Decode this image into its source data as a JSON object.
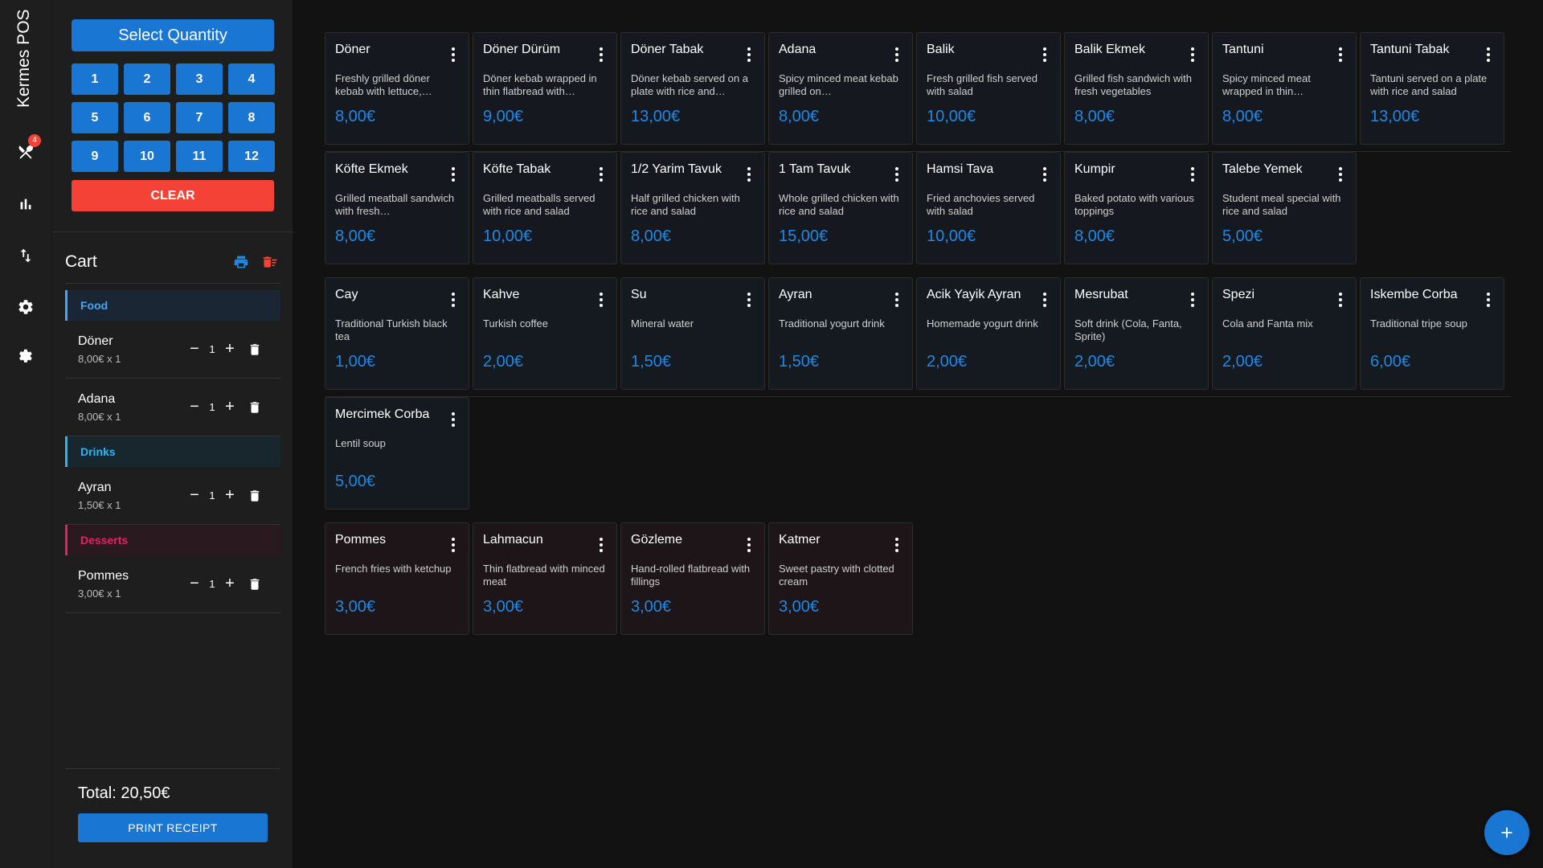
{
  "app": {
    "title": "Kermes POS",
    "cart_badge": "4"
  },
  "quantity": {
    "select_label": "Select Quantity",
    "numbers": [
      "1",
      "2",
      "3",
      "4",
      "5",
      "6",
      "7",
      "8",
      "9",
      "10",
      "11",
      "12"
    ],
    "clear_label": "CLEAR"
  },
  "cart": {
    "title": "Cart",
    "groups": [
      {
        "category": "Food",
        "color": "#42a5f5",
        "bg": "#1a2633",
        "items": [
          {
            "name": "Döner",
            "sub": "8,00€ x 1",
            "qty": "1"
          },
          {
            "name": "Adana",
            "sub": "8,00€ x 1",
            "qty": "1"
          }
        ]
      },
      {
        "category": "Drinks",
        "color": "#29b6f6",
        "bg": "#18262e",
        "items": [
          {
            "name": "Ayran",
            "sub": "1,50€ x 1",
            "qty": "1"
          }
        ]
      },
      {
        "category": "Desserts",
        "color": "#e91e63",
        "bg": "#2a1a20",
        "items": [
          {
            "name": "Pommes",
            "sub": "3,00€ x 1",
            "qty": "1"
          }
        ]
      }
    ],
    "total": "Total: 20,50€",
    "print_label": "PRINT RECEIPT"
  },
  "menu": {
    "food_row1": [
      {
        "name": "Döner",
        "desc": "Freshly grilled döner kebab with lettuce,…",
        "price": "8,00€"
      },
      {
        "name": "Döner Dürüm",
        "desc": "Döner kebab wrapped in thin flatbread with…",
        "price": "9,00€"
      },
      {
        "name": "Döner Tabak",
        "desc": "Döner kebab served on a plate with rice and…",
        "price": "13,00€"
      },
      {
        "name": "Adana",
        "desc": "Spicy minced meat kebab grilled on…",
        "price": "8,00€"
      },
      {
        "name": "Balik",
        "desc": "Fresh grilled fish served with salad",
        "price": "10,00€"
      },
      {
        "name": "Balik Ekmek",
        "desc": "Grilled fish sandwich with fresh vegetables",
        "price": "8,00€"
      },
      {
        "name": "Tantuni",
        "desc": "Spicy minced meat wrapped in thin…",
        "price": "8,00€"
      },
      {
        "name": "Tantuni Tabak",
        "desc": "Tantuni served on a plate with rice and salad",
        "price": "13,00€"
      }
    ],
    "food_row2": [
      {
        "name": "Köfte Ekmek",
        "desc": "Grilled meatball sandwich with fresh…",
        "price": "8,00€"
      },
      {
        "name": "Köfte Tabak",
        "desc": "Grilled meatballs served with rice and salad",
        "price": "10,00€"
      },
      {
        "name": "1/2 Yarim Tavuk",
        "desc": "Half grilled chicken with rice and salad",
        "price": "8,00€"
      },
      {
        "name": "1 Tam Tavuk",
        "desc": "Whole grilled chicken with rice and salad",
        "price": "15,00€"
      },
      {
        "name": "Hamsi Tava",
        "desc": "Fried anchovies served with salad",
        "price": "10,00€"
      },
      {
        "name": "Kumpir",
        "desc": "Baked potato with various toppings",
        "price": "8,00€"
      },
      {
        "name": "Talebe Yemek",
        "desc": "Student meal special with rice and salad",
        "price": "5,00€"
      }
    ],
    "drink_row1": [
      {
        "name": "Cay",
        "desc": "Traditional Turkish black tea",
        "price": "1,00€"
      },
      {
        "name": "Kahve",
        "desc": "Turkish coffee",
        "price": "2,00€"
      },
      {
        "name": "Su",
        "desc": "Mineral water",
        "price": "1,50€"
      },
      {
        "name": "Ayran",
        "desc": "Traditional yogurt drink",
        "price": "1,50€"
      },
      {
        "name": "Acik Yayik Ayran",
        "desc": "Homemade yogurt drink",
        "price": "2,00€"
      },
      {
        "name": "Mesrubat",
        "desc": "Soft drink (Cola, Fanta, Sprite)",
        "price": "2,00€"
      },
      {
        "name": "Spezi",
        "desc": "Cola and Fanta mix",
        "price": "2,00€"
      },
      {
        "name": "Iskembe Corba",
        "desc": "Traditional tripe soup",
        "price": "6,00€"
      }
    ],
    "drink_row2": [
      {
        "name": "Mercimek Corba",
        "desc": "Lentil soup",
        "price": "5,00€"
      }
    ],
    "dessert_row1": [
      {
        "name": "Pommes",
        "desc": "French fries with ketchup",
        "price": "3,00€"
      },
      {
        "name": "Lahmacun",
        "desc": "Thin flatbread with minced meat",
        "price": "3,00€"
      },
      {
        "name": "Gözleme",
        "desc": "Hand-rolled flatbread with fillings",
        "price": "3,00€"
      },
      {
        "name": "Katmer",
        "desc": "Sweet pastry with clotted cream",
        "price": "3,00€"
      }
    ]
  },
  "colors": {
    "accent": "#1976d2",
    "price": "#1e88e5",
    "danger": "#f44336"
  }
}
